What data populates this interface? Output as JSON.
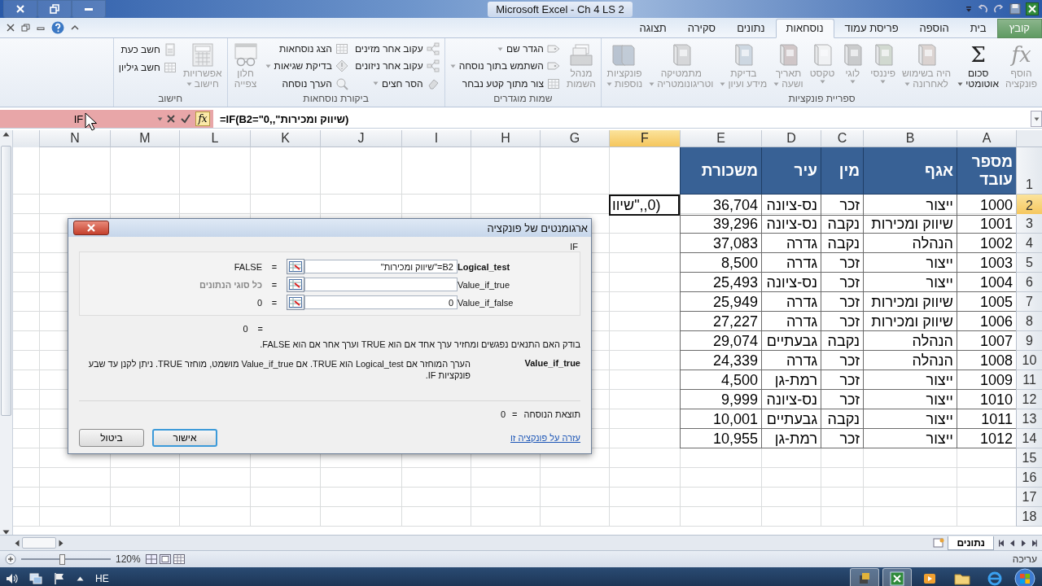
{
  "window": {
    "title": "Microsoft Excel - Ch 4 LS 2"
  },
  "ribbon": {
    "tabs": [
      {
        "label": "קובץ",
        "kind": "file",
        "selected": false
      },
      {
        "label": "בית",
        "kind": "tab",
        "selected": false
      },
      {
        "label": "הוספה",
        "kind": "tab",
        "selected": false
      },
      {
        "label": "פריסת עמוד",
        "kind": "tab",
        "selected": false
      },
      {
        "label": "נוסחאות",
        "kind": "tab",
        "selected": true
      },
      {
        "label": "נתונים",
        "kind": "tab",
        "selected": false
      },
      {
        "label": "סקירה",
        "kind": "tab",
        "selected": false
      },
      {
        "label": "תצוגה",
        "kind": "tab",
        "selected": false
      }
    ],
    "groups": [
      {
        "label": "ספריית פונקציות",
        "columns": [
          {
            "kind": "large",
            "items": [
              {
                "label": "הוסף\nפונקציה",
                "glyph": "fx",
                "disabled": true,
                "dropdown": false
              },
              {
                "label": "סכום\nאוטומטי",
                "glyph": "Σ",
                "disabled": false,
                "dropdown": true
              },
              {
                "label": "היה בשימוש\nלאחרונה",
                "disabled": true,
                "dropdown": true
              },
              {
                "label": "פיננסי",
                "disabled": true,
                "dropdown": true
              },
              {
                "label": "לוגי",
                "disabled": true,
                "dropdown": true
              },
              {
                "label": "טקסט",
                "disabled": true,
                "dropdown": true
              },
              {
                "label": "תאריך\nושעה",
                "disabled": true,
                "dropdown": true
              },
              {
                "label": "בדיקת\nמידע ועיון",
                "disabled": true,
                "dropdown": true
              },
              {
                "label": "מתמטיקה\nוטריגונומטריה",
                "disabled": true,
                "dropdown": true
              },
              {
                "label": "פונקציות\nנוספות",
                "disabled": true,
                "dropdown": true
              }
            ]
          }
        ]
      },
      {
        "label": "שמות מוגדרים",
        "columns": [
          {
            "kind": "large",
            "items": [
              {
                "label": "מנהל\nהשמות",
                "disabled": true,
                "dropdown": false
              }
            ]
          },
          {
            "kind": "small",
            "items": [
              {
                "label": "הגדר שם",
                "disabled": true,
                "dropdown": true
              },
              {
                "label": "השתמש בתוך נוסחה",
                "disabled": true,
                "dropdown": true
              },
              {
                "label": "צור מתוך קטע נבחר",
                "disabled": true,
                "dropdown": false
              }
            ]
          }
        ]
      },
      {
        "label": "ביקורת נוסחאות",
        "columns": [
          {
            "kind": "small",
            "items": [
              {
                "label": "עקוב אחר מזינים",
                "disabled": true,
                "dropdown": false
              },
              {
                "label": "עקוב אחר ניזונים",
                "disabled": true,
                "dropdown": false
              },
              {
                "label": "הסר חצים",
                "disabled": true,
                "dropdown": true
              }
            ]
          },
          {
            "kind": "small",
            "items": [
              {
                "label": "הצג נוסחאות",
                "disabled": true,
                "dropdown": false
              },
              {
                "label": "בדיקת שגיאות",
                "disabled": true,
                "dropdown": true
              },
              {
                "label": "הערך נוסחה",
                "disabled": true,
                "dropdown": false
              }
            ]
          },
          {
            "kind": "large",
            "items": [
              {
                "label": "חלון\nצפייה",
                "disabled": true,
                "dropdown": false
              }
            ]
          }
        ]
      },
      {
        "label": "חישוב",
        "columns": [
          {
            "kind": "large",
            "items": [
              {
                "label": "אפשרויות\nחישוב",
                "disabled": true,
                "dropdown": true
              }
            ]
          },
          {
            "kind": "small",
            "items": [
              {
                "label": "חשב כעת",
                "disabled": true,
                "dropdown": false
              },
              {
                "label": "חשב גיליון",
                "disabled": true,
                "dropdown": false
              }
            ]
          }
        ]
      }
    ]
  },
  "formula_bar": {
    "name_box": "IF",
    "fx_glyph": "fx",
    "formula": "=IF(B2=\"שיווק ומכירות\",,0)"
  },
  "grid": {
    "columns": [
      {
        "label": "A",
        "selected": false
      },
      {
        "label": "B",
        "selected": false
      },
      {
        "label": "C",
        "selected": false
      },
      {
        "label": "D",
        "selected": false
      },
      {
        "label": "E",
        "selected": false
      },
      {
        "label": "F",
        "selected": true
      },
      {
        "label": "G",
        "selected": false
      },
      {
        "label": "H",
        "selected": false
      },
      {
        "label": "I",
        "selected": false
      },
      {
        "label": "J",
        "selected": false
      },
      {
        "label": "K",
        "selected": false
      },
      {
        "label": "L",
        "selected": false
      },
      {
        "label": "M",
        "selected": false
      },
      {
        "label": "N",
        "selected": false
      }
    ],
    "rows": [
      {
        "number": "1",
        "kind": "header",
        "selected": false,
        "cells": [
          "מספר\nעובד",
          "אגף",
          "מין",
          "עיר",
          "משכורת"
        ]
      },
      {
        "number": "2",
        "kind": "data",
        "selected": true,
        "cells": [
          "1000",
          "ייצור",
          "זכר",
          "נס-ציונה",
          "36,704"
        ],
        "edit_text": "(0,,\"שיוו"
      },
      {
        "number": "3",
        "kind": "data",
        "selected": false,
        "cells": [
          "1001",
          "שיווק ומכירות",
          "נקבה",
          "נס-ציונה",
          "39,296"
        ]
      },
      {
        "number": "4",
        "kind": "data",
        "selected": false,
        "cells": [
          "1002",
          "הנהלה",
          "נקבה",
          "גדרה",
          "37,083"
        ]
      },
      {
        "number": "5",
        "kind": "data",
        "selected": false,
        "cells": [
          "1003",
          "ייצור",
          "זכר",
          "גדרה",
          "8,500"
        ]
      },
      {
        "number": "6",
        "kind": "data",
        "selected": false,
        "cells": [
          "1004",
          "ייצור",
          "זכר",
          "נס-ציונה",
          "25,493"
        ]
      },
      {
        "number": "7",
        "kind": "data",
        "selected": false,
        "cells": [
          "1005",
          "שיווק ומכירות",
          "זכר",
          "גדרה",
          "25,949"
        ]
      },
      {
        "number": "8",
        "kind": "data",
        "selected": false,
        "cells": [
          "1006",
          "שיווק ומכירות",
          "זכר",
          "גדרה",
          "27,227"
        ]
      },
      {
        "number": "9",
        "kind": "data",
        "selected": false,
        "cells": [
          "1007",
          "הנהלה",
          "נקבה",
          "גבעתיים",
          "29,074"
        ]
      },
      {
        "number": "10",
        "kind": "data",
        "selected": false,
        "cells": [
          "1008",
          "הנהלה",
          "זכר",
          "גדרה",
          "24,339"
        ]
      },
      {
        "number": "11",
        "kind": "data",
        "selected": false,
        "cells": [
          "1009",
          "ייצור",
          "זכר",
          "רמת-גן",
          "4,500"
        ]
      },
      {
        "number": "12",
        "kind": "data",
        "selected": false,
        "cells": [
          "1010",
          "ייצור",
          "זכר",
          "נס-ציונה",
          "9,999"
        ]
      },
      {
        "number": "13",
        "kind": "data",
        "selected": false,
        "cells": [
          "1011",
          "ייצור",
          "נקבה",
          "גבעתיים",
          "10,001"
        ]
      },
      {
        "number": "14",
        "kind": "data",
        "selected": false,
        "cells": [
          "1012",
          "ייצור",
          "זכר",
          "רמת-גן",
          "10,955"
        ]
      },
      {
        "number": "15",
        "kind": "data",
        "selected": false
      },
      {
        "number": "16",
        "kind": "data",
        "selected": false
      },
      {
        "number": "17",
        "kind": "data",
        "selected": false
      },
      {
        "number": "18",
        "kind": "data",
        "selected": false
      }
    ]
  },
  "dialog": {
    "title": "ארגומנטים של פונקציה",
    "function": "IF",
    "arguments": [
      {
        "name": "Logical_test",
        "active": true,
        "value": "B2=\"שיווק ומכירות\"",
        "equals": "=",
        "result": "FALSE",
        "hint": false
      },
      {
        "name": "Value_if_true",
        "active": false,
        "equals": "=",
        "result": "כל סוגי הנתונים",
        "hint": true
      },
      {
        "name": "Value_if_false",
        "active": false,
        "value": "0",
        "equals": "=",
        "result": "0",
        "hint": false
      }
    ],
    "preview_equals": "=",
    "preview_result": "0",
    "description": "בודק האם התנאים נפגשים ומחזיר ערך אחד אם הוא TRUE וערך אחר אם הוא FALSE.",
    "argument_help_name": "Value_if_true",
    "argument_help": "הערך המוחזר אם Logical_test הוא TRUE. אם Value_if_true מושמט, מוחזר TRUE. ניתן לקנן עד שבע פונקציות IF.",
    "formula_result_label": "תוצאת הנוסחה",
    "formula_result_equals": "=",
    "formula_result": "0",
    "help_link": "עזרה על פונקציה זו",
    "buttons": [
      {
        "label": "אישור",
        "default": true
      },
      {
        "label": "ביטול",
        "default": false
      }
    ]
  },
  "sheet_tabs": [
    {
      "label": "נתונים",
      "selected": true
    }
  ],
  "status_bar": {
    "mode": "עריכה",
    "zoom": "120%",
    "zoom_slider": {
      "level": 0.45
    }
  },
  "taskbar": {
    "apps": [
      {
        "selected": true
      },
      {
        "selected": true
      },
      {
        "selected": false
      },
      {
        "selected": false
      },
      {
        "selected": false
      }
    ],
    "language": "HE"
  }
}
